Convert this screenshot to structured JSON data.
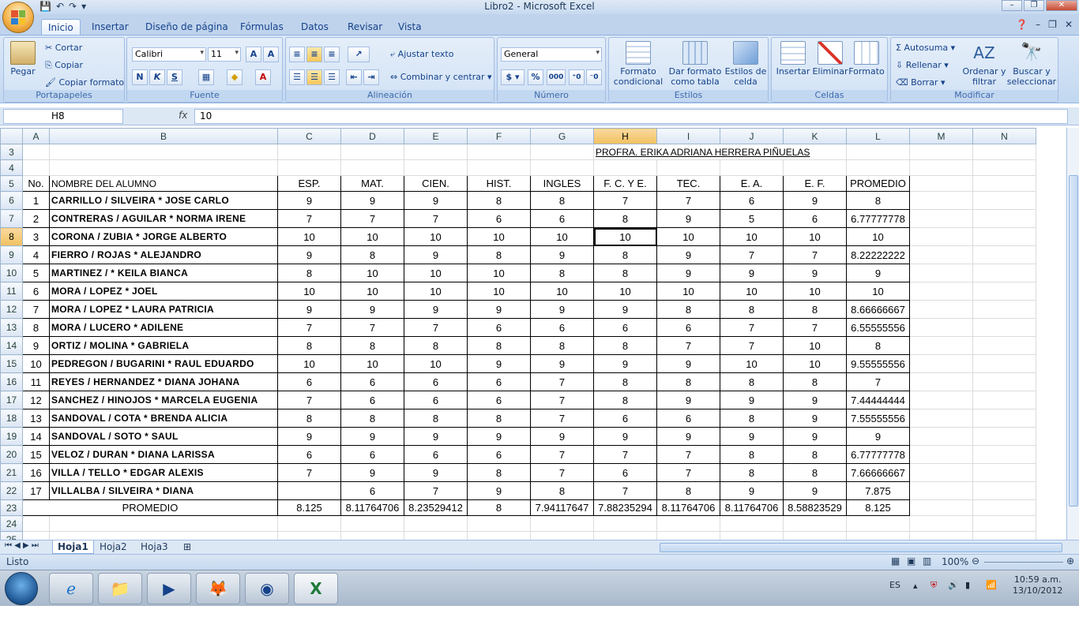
{
  "window": {
    "title": "Libro2 - Microsoft Excel"
  },
  "ribbon_tabs": [
    "Inicio",
    "Insertar",
    "Diseño de página",
    "Fórmulas",
    "Datos",
    "Revisar",
    "Vista"
  ],
  "ribbon": {
    "portapapeles": {
      "label": "Portapapeles",
      "pegar": "Pegar",
      "cortar": "Cortar",
      "copiar": "Copiar",
      "copiar_formato": "Copiar formato"
    },
    "fuente": {
      "label": "Fuente",
      "font": "Calibri",
      "size": "11"
    },
    "alineacion": {
      "label": "Alineación",
      "ajustar": "Ajustar texto",
      "combinar": "Combinar y centrar"
    },
    "numero": {
      "label": "Número",
      "format": "General"
    },
    "estilos": {
      "label": "Estilos",
      "formato_cond": "Formato condicional",
      "dar_formato": "Dar formato como tabla",
      "estilos_celda": "Estilos de celda"
    },
    "celdas": {
      "label": "Celdas",
      "insertar": "Insertar",
      "eliminar": "Eliminar",
      "formato": "Formato"
    },
    "modificar": {
      "label": "Modificar",
      "autosuma": "Autosuma",
      "rellenar": "Rellenar",
      "borrar": "Borrar",
      "ordenar": "Ordenar y filtrar",
      "buscar": "Buscar y seleccionar"
    }
  },
  "formula_bar": {
    "cell": "H8",
    "value": "10"
  },
  "columns": [
    "A",
    "B",
    "C",
    "D",
    "E",
    "F",
    "G",
    "H",
    "I",
    "J",
    "K",
    "L",
    "M",
    "N"
  ],
  "title_row": {
    "row": "3",
    "text": "PROFRA. ERIKA ADRIANA HERRERA PIÑUELAS"
  },
  "header_row": {
    "row": "5",
    "cells": [
      "No.",
      "NOMBRE DEL ALUMNO",
      "ESP.",
      "MAT.",
      "CIEN.",
      "HIST.",
      "INGLES",
      "F. C. Y E.",
      "TEC.",
      "E. A.",
      "E. F.",
      "PROMEDIO"
    ]
  },
  "students": [
    {
      "row": "6",
      "no": "1",
      "name": "CARRILLO / SILVEIRA * JOSE CARLO",
      "g": [
        "9",
        "9",
        "9",
        "8",
        "8",
        "7",
        "7",
        "6",
        "9"
      ],
      "avg": "8"
    },
    {
      "row": "7",
      "no": "2",
      "name": "CONTRERAS / AGUILAR * NORMA IRENE",
      "g": [
        "7",
        "7",
        "7",
        "6",
        "6",
        "8",
        "9",
        "5",
        "6"
      ],
      "avg": "6.77777778"
    },
    {
      "row": "8",
      "no": "3",
      "name": "CORONA / ZUBIA * JORGE ALBERTO",
      "g": [
        "10",
        "10",
        "10",
        "10",
        "10",
        "10",
        "10",
        "10",
        "10"
      ],
      "avg": "10"
    },
    {
      "row": "9",
      "no": "4",
      "name": "FIERRO / ROJAS * ALEJANDRO",
      "g": [
        "9",
        "8",
        "9",
        "8",
        "9",
        "8",
        "9",
        "7",
        "7"
      ],
      "avg": "8.22222222"
    },
    {
      "row": "10",
      "no": "5",
      "name": "MARTINEZ / * KEILA BIANCA",
      "g": [
        "8",
        "10",
        "10",
        "10",
        "8",
        "8",
        "9",
        "9",
        "9"
      ],
      "avg": "9"
    },
    {
      "row": "11",
      "no": "6",
      "name": "MORA / LOPEZ * JOEL",
      "g": [
        "10",
        "10",
        "10",
        "10",
        "10",
        "10",
        "10",
        "10",
        "10"
      ],
      "avg": "10"
    },
    {
      "row": "12",
      "no": "7",
      "name": "MORA / LOPEZ * LAURA PATRICIA",
      "g": [
        "9",
        "9",
        "9",
        "9",
        "9",
        "9",
        "8",
        "8",
        "8"
      ],
      "avg": "8.66666667"
    },
    {
      "row": "13",
      "no": "8",
      "name": "MORA / LUCERO * ADILENE",
      "g": [
        "7",
        "7",
        "7",
        "6",
        "6",
        "6",
        "6",
        "7",
        "7"
      ],
      "avg": "6.55555556"
    },
    {
      "row": "14",
      "no": "9",
      "name": "ORTIZ / MOLINA * GABRIELA",
      "g": [
        "8",
        "8",
        "8",
        "8",
        "8",
        "8",
        "7",
        "7",
        "10"
      ],
      "avg": "8"
    },
    {
      "row": "15",
      "no": "10",
      "name": "PEDREGON / BUGARINI * RAUL EDUARDO",
      "g": [
        "10",
        "10",
        "10",
        "9",
        "9",
        "9",
        "9",
        "10",
        "10"
      ],
      "avg": "9.55555556"
    },
    {
      "row": "16",
      "no": "11",
      "name": "REYES / HERNANDEZ * DIANA JOHANA",
      "g": [
        "6",
        "6",
        "6",
        "6",
        "7",
        "8",
        "8",
        "8",
        "8"
      ],
      "avg": "7"
    },
    {
      "row": "17",
      "no": "12",
      "name": "SANCHEZ / HINOJOS * MARCELA EUGENIA",
      "g": [
        "7",
        "6",
        "6",
        "6",
        "7",
        "8",
        "9",
        "9",
        "9"
      ],
      "avg": "7.44444444"
    },
    {
      "row": "18",
      "no": "13",
      "name": "SANDOVAL / COTA * BRENDA ALICIA",
      "g": [
        "8",
        "8",
        "8",
        "8",
        "7",
        "6",
        "6",
        "8",
        "9"
      ],
      "avg": "7.55555556"
    },
    {
      "row": "19",
      "no": "14",
      "name": "SANDOVAL / SOTO * SAUL",
      "g": [
        "9",
        "9",
        "9",
        "9",
        "9",
        "9",
        "9",
        "9",
        "9"
      ],
      "avg": "9"
    },
    {
      "row": "20",
      "no": "15",
      "name": "VELOZ / DURAN * DIANA LARISSA",
      "g": [
        "6",
        "6",
        "6",
        "6",
        "7",
        "7",
        "7",
        "8",
        "8"
      ],
      "avg": "6.77777778"
    },
    {
      "row": "21",
      "no": "16",
      "name": "VILLA / TELLO * EDGAR ALEXIS",
      "g": [
        "7",
        "9",
        "9",
        "8",
        "7",
        "6",
        "7",
        "8",
        "8"
      ],
      "avg": "7.66666667"
    },
    {
      "row": "22",
      "no": "17",
      "name": "VILLALBA / SILVEIRA * DIANA",
      "g": [
        "",
        "6",
        "7",
        "9",
        "8",
        "7",
        "8",
        "9",
        "9"
      ],
      "avg": "7.875"
    }
  ],
  "average_row": {
    "row": "23",
    "label": "PROMEDIO",
    "values": [
      "8.125",
      "8.11764706",
      "8.23529412",
      "8",
      "7.94117647",
      "7.88235294",
      "8.11764706",
      "8.11764706",
      "8.58823529",
      "8.125"
    ]
  },
  "sheets": [
    "Hoja1",
    "Hoja2",
    "Hoja3"
  ],
  "status": {
    "text": "Listo",
    "zoom": "100%"
  },
  "tray": {
    "lang": "ES",
    "time": "10:59 a.m.",
    "date": "13/10/2012"
  }
}
